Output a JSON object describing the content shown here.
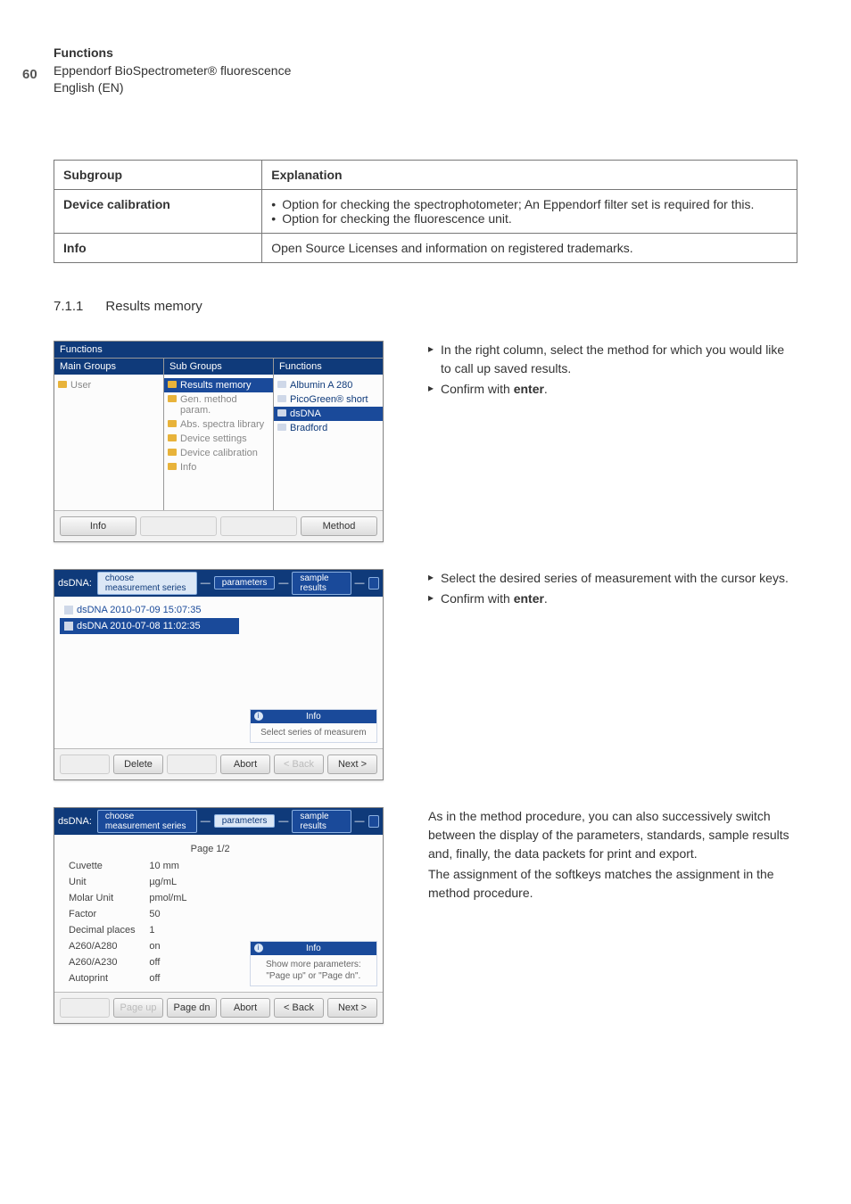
{
  "page": {
    "number": "60"
  },
  "header": {
    "line1": "Functions",
    "line2": "Eppendorf BioSpectrometer® fluorescence",
    "line3": "English (EN)"
  },
  "table": {
    "head": {
      "c1": "Subgroup",
      "c2": "Explanation"
    },
    "rows": [
      {
        "c1": "Device calibration",
        "bullets": [
          "Option for checking the spectrophotometer; An Eppendorf filter set is required for this.",
          "Option for checking the fluorescence unit."
        ]
      },
      {
        "c1": "Info",
        "c2": "Open Source Licenses and information on registered trademarks."
      }
    ]
  },
  "section": {
    "num": "7.1.1",
    "title": "Results memory"
  },
  "sc1": {
    "title": "Functions",
    "colheads": [
      "Main Groups",
      "Sub Groups",
      "Functions"
    ],
    "col1": [
      "User"
    ],
    "col2": [
      "Results memory",
      "Gen. method param.",
      "Abs. spectra library",
      "Device settings",
      "Device calibration",
      "Info"
    ],
    "col3": [
      "Albumin A 280",
      "PicoGreen® short",
      "dsDNA",
      "Bradford"
    ],
    "footer": [
      "Info",
      "",
      "",
      "Method"
    ]
  },
  "right1": {
    "b1": "In the right column, select the method for which you would like to call up saved results.",
    "b2_pre": "Confirm with ",
    "b2_strong": "enter",
    "b2_post": "."
  },
  "sc2": {
    "prefix": "dsDNA:",
    "tabs": [
      "choose measurement series",
      "parameters",
      "sample results"
    ],
    "series": [
      "dsDNA 2010-07-09 15:07:35",
      "dsDNA 2010-07-08 11:02:35"
    ],
    "info_title": "Info",
    "info_body": "Select series of measurem",
    "footer": [
      "",
      "Delete",
      "",
      "Abort",
      "< Back",
      "Next >"
    ]
  },
  "right2": {
    "b1": "Select the desired series of measurement with the cursor keys.",
    "b2_pre": "Confirm with ",
    "b2_strong": "enter",
    "b2_post": "."
  },
  "sc3": {
    "prefix": "dsDNA:",
    "tabs": [
      "choose measurement series",
      "parameters",
      "sample results"
    ],
    "page_ind": "Page 1/2",
    "params": [
      {
        "k": "Cuvette",
        "v": "10 mm"
      },
      {
        "k": "Unit",
        "v": "µg/mL"
      },
      {
        "k": "Molar Unit",
        "v": "pmol/mL"
      },
      {
        "k": "Factor",
        "v": "50"
      },
      {
        "k": "Decimal places",
        "v": "1"
      },
      {
        "k": "A260/A280",
        "v": "on"
      },
      {
        "k": "A260/A230",
        "v": "off"
      },
      {
        "k": "Autoprint",
        "v": "off"
      }
    ],
    "info_title": "Info",
    "info_body": "Show more parameters: \"Page up\" or \"Page dn\".",
    "footer": [
      "",
      "Page up",
      "Page dn",
      "Abort",
      "< Back",
      "Next >"
    ]
  },
  "right3": {
    "p1": "As in the method procedure, you can also successively switch between the display of the parameters, standards, sample results and, finally, the data packets for print and export.",
    "p2": "The assignment of the softkeys matches the assignment in the method procedure."
  }
}
